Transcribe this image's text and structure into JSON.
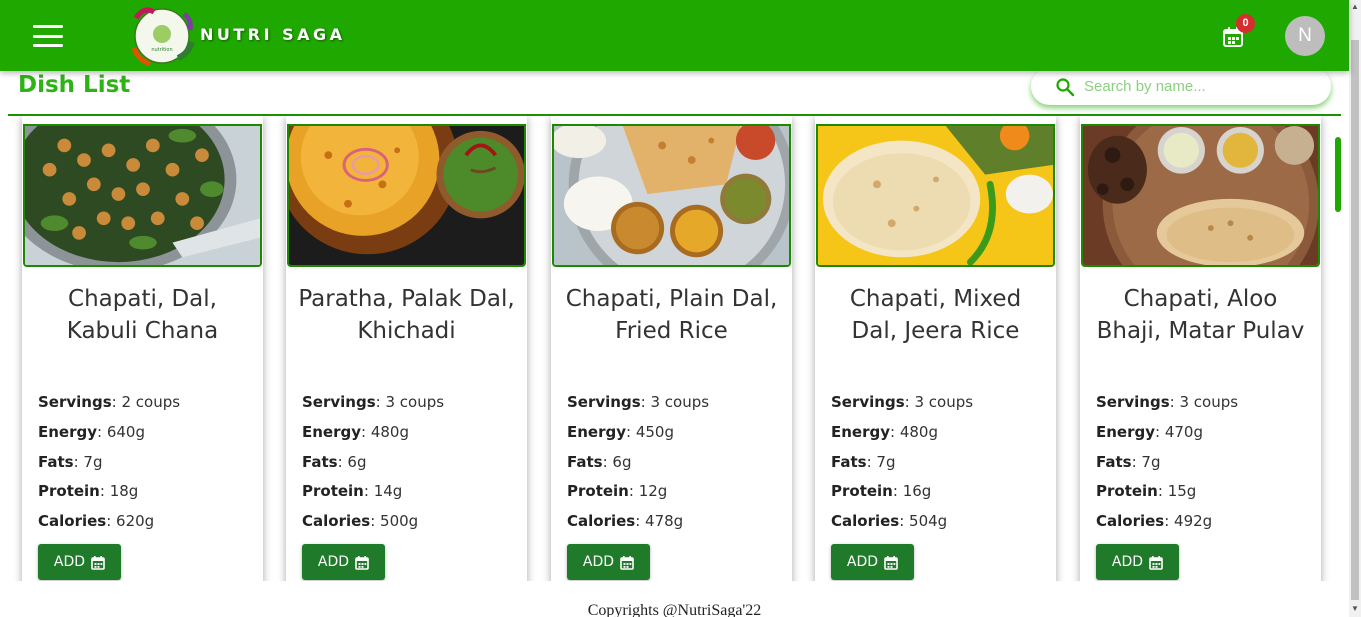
{
  "appbar": {
    "brand": "NUTRI SAGA",
    "logo_text": "NUTRI SAGA",
    "cart_count": "0",
    "avatar_initial": "N",
    "color": "#1fa800"
  },
  "header": {
    "title": "Dish List",
    "search_placeholder": "Search by name..."
  },
  "labels": {
    "servings": "Servings",
    "energy": "Energy",
    "fats": "Fats",
    "protein": "Protein",
    "calories": "Calories",
    "add": "ADD"
  },
  "dishes": [
    {
      "name": "Chapati, Dal, Kabuli Chana",
      "servings": "2 coups",
      "energy": "640g",
      "fats": "7g",
      "protein": "18g",
      "calories": "620g"
    },
    {
      "name": "Paratha, Palak Dal, Khichadi",
      "servings": "3 coups",
      "energy": "480g",
      "fats": "6g",
      "protein": "14g",
      "calories": "500g"
    },
    {
      "name": "Chapati, Plain Dal, Fried Rice",
      "servings": "3 coups",
      "energy": "450g",
      "fats": "6g",
      "protein": "12g",
      "calories": "478g"
    },
    {
      "name": "Chapati, Mixed Dal, Jeera Rice",
      "servings": "3 coups",
      "energy": "480g",
      "fats": "7g",
      "protein": "16g",
      "calories": "504g"
    },
    {
      "name": "Chapati, Aloo Bhaji, Matar Pulav",
      "servings": "3 coups",
      "energy": "470g",
      "fats": "7g",
      "protein": "15g",
      "calories": "492g"
    }
  ],
  "footer": {
    "text": "Copyrights @NutriSaga'22"
  }
}
